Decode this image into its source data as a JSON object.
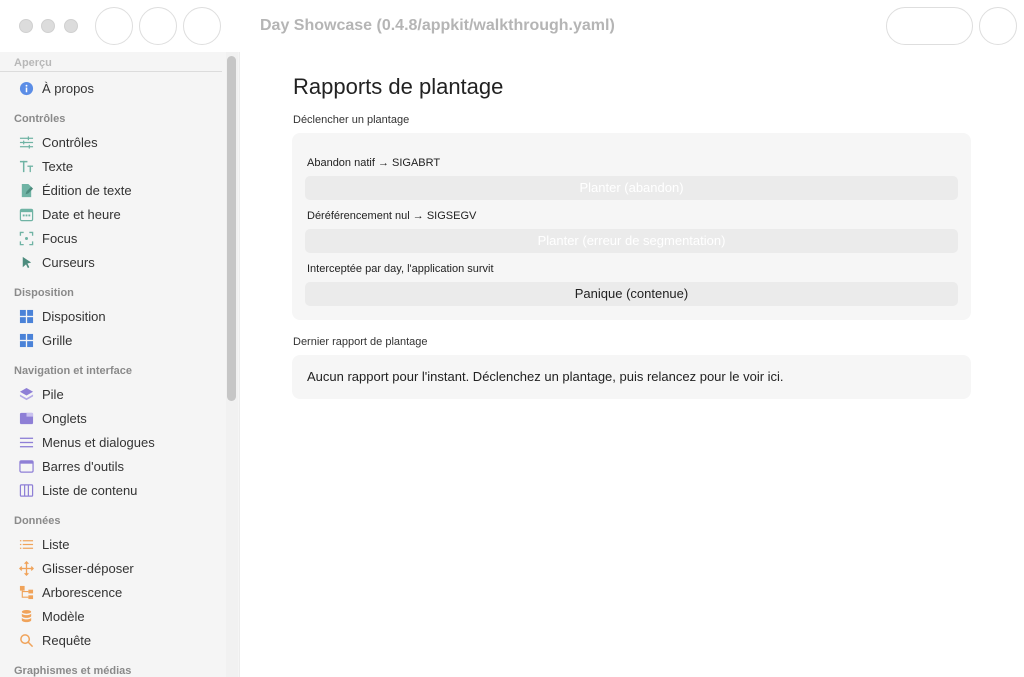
{
  "window": {
    "title": "Day Showcase (0.4.8/appkit/walkthrough.yaml)"
  },
  "sidebar": {
    "sections": [
      {
        "title": "Aperçu",
        "items": [
          {
            "label": "À propos",
            "icon": "info-icon"
          }
        ]
      },
      {
        "title": "Contrôles",
        "items": [
          {
            "label": "Contrôles",
            "icon": "sliders-icon"
          },
          {
            "label": "Texte",
            "icon": "text-icon"
          },
          {
            "label": "Édition de texte",
            "icon": "edit-document-icon"
          },
          {
            "label": "Date et heure",
            "icon": "calendar-icon"
          },
          {
            "label": "Focus",
            "icon": "focus-icon"
          },
          {
            "label": "Curseurs",
            "icon": "cursor-icon"
          }
        ]
      },
      {
        "title": "Disposition",
        "items": [
          {
            "label": "Disposition",
            "icon": "layout-grid-icon"
          },
          {
            "label": "Grille",
            "icon": "grid-icon"
          }
        ]
      },
      {
        "title": "Navigation et interface",
        "items": [
          {
            "label": "Pile",
            "icon": "stack-icon"
          },
          {
            "label": "Onglets",
            "icon": "tabs-icon"
          },
          {
            "label": "Menus et dialogues",
            "icon": "menu-icon"
          },
          {
            "label": "Barres d'outils",
            "icon": "toolbar-icon"
          },
          {
            "label": "Liste de contenu",
            "icon": "columns-icon"
          }
        ]
      },
      {
        "title": "Données",
        "items": [
          {
            "label": "Liste",
            "icon": "list-icon"
          },
          {
            "label": "Glisser-déposer",
            "icon": "move-icon"
          },
          {
            "label": "Arborescence",
            "icon": "tree-icon"
          },
          {
            "label": "Modèle",
            "icon": "database-icon"
          },
          {
            "label": "Requête",
            "icon": "search-icon"
          }
        ]
      },
      {
        "title": "Graphismes et médias",
        "items": []
      }
    ]
  },
  "main": {
    "title": "Rapports de plantage",
    "trigger_section": {
      "label": "Déclencher un plantage",
      "rows": [
        {
          "label": "Abandon natif → SIGABRT",
          "button": "Planter (abandon)",
          "enabled": false
        },
        {
          "label": "Déréférencement nul → SIGSEGV",
          "button": "Planter (erreur de segmentation)",
          "enabled": false
        },
        {
          "label": "Interceptée par day, l'application survit",
          "button": "Panique (contenue)",
          "enabled": true
        }
      ]
    },
    "report_section": {
      "label": "Dernier rapport de plantage",
      "text": "Aucun rapport pour l'instant. Déclenchez un plantage, puis relancez pour le voir ici."
    }
  },
  "colors": {
    "info": "#5b8de6",
    "controls": "#6fb3a4",
    "layout": "#4a82d8",
    "navigation": "#8e7fd6",
    "data": "#f0a35a"
  }
}
